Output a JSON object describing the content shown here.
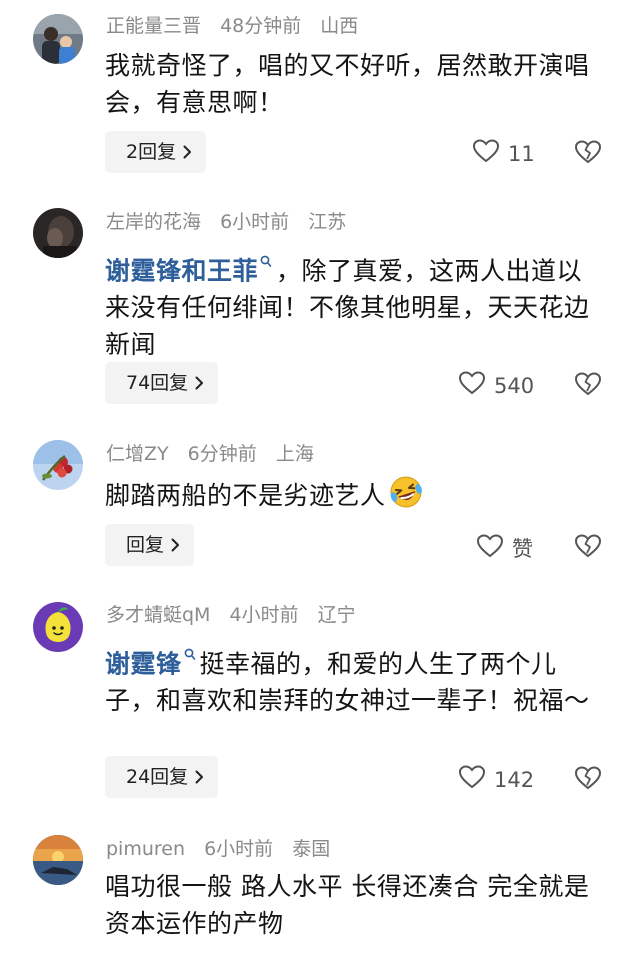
{
  "comments": [
    {
      "username": "正能量三晋",
      "time": "48分钟前",
      "location": "山西",
      "text": "我就奇怪了，唱的又不好听，居然敢开演唱会，有意思啊！",
      "reply_label": "2回复",
      "likes": "11"
    },
    {
      "username": "左岸的花海",
      "time": "6小时前",
      "location": "江苏",
      "mention": "谢霆锋和王菲",
      "text": "，除了真爱，这两人出道以来没有任何绯闻！不像其他明星，天天花边新闻",
      "reply_label": "74回复",
      "likes": "540"
    },
    {
      "username": "仁增ZY",
      "time": "6分钟前",
      "location": "上海",
      "text": "脚踏两船的不是劣迹艺人",
      "emoji": "laughing-crying-emoji",
      "reply_label": "回复",
      "likes": "赞"
    },
    {
      "username": "多才蜻蜓qM",
      "time": "4小时前",
      "location": "辽宁",
      "mention": "谢霆锋",
      "text": "挺幸福的，和爱的人生了两个儿子，和喜欢和崇拜的女神过一辈子！祝福～",
      "reply_label": "24回复",
      "likes": "142"
    },
    {
      "username": "pimuren",
      "time": "6小时前",
      "location": "泰国",
      "text": "唱功很一般 路人水平 长得还凑合 完全就是资本运作的产物"
    }
  ],
  "colors": {
    "mention": "#2f5f9a",
    "meta": "#8a8a8a",
    "button_bg": "#f3f3f3"
  },
  "icons": [
    "chevron-right-icon",
    "heart-icon",
    "broken-heart-icon",
    "search-mention-icon"
  ]
}
